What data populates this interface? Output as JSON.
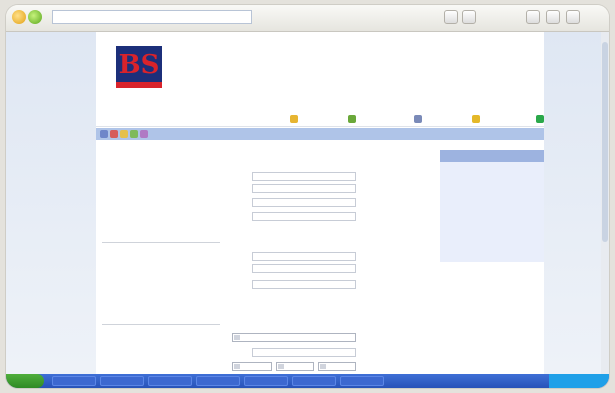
{
  "browser": {
    "url": "",
    "icons": [
      "back-icon",
      "forward-icon",
      "page-icon",
      "tools-icon",
      "home-icon",
      "print-icon",
      "mail-icon"
    ]
  },
  "header": {
    "logo_letters": "BS",
    "logo_tagline": ""
  },
  "menu": {
    "items": [
      "",
      "",
      "",
      "",
      ""
    ]
  },
  "breadcrumb": "",
  "nav": {
    "title": "",
    "links": [
      "",
      "",
      "",
      "",
      "",
      "",
      "",
      ""
    ]
  },
  "form": {
    "fields": [
      {
        "label": "",
        "value": ""
      },
      {
        "label": "",
        "value": ""
      },
      {
        "label": "",
        "value": ""
      },
      {
        "label": "",
        "value": ""
      },
      {
        "label": "",
        "value": ""
      },
      {
        "label": "",
        "value": ""
      },
      {
        "label": "",
        "value": ""
      },
      {
        "label": "",
        "value": ""
      }
    ]
  },
  "help": [
    {
      "title": "",
      "body": ""
    },
    {
      "title": "",
      "body": ""
    },
    {
      "title": "",
      "body": ""
    }
  ],
  "taskbar": {
    "start_label": "",
    "tasks": [
      "",
      "",
      "",
      "",
      "",
      "",
      ""
    ],
    "clock": ""
  },
  "colors": {
    "accent_blue": "#1c2f7a",
    "accent_red": "#d9232b",
    "nav_header": "#9db3e0"
  }
}
